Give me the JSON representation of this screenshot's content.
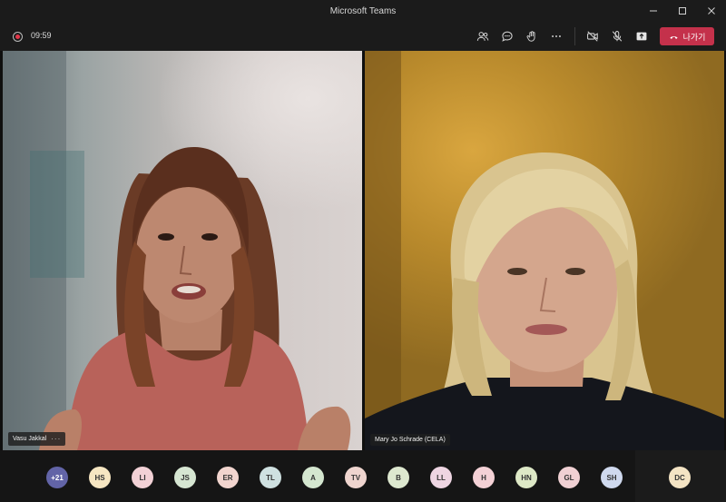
{
  "window": {
    "title": "Microsoft Teams"
  },
  "toolbar": {
    "timer": "09:59",
    "leave_label": "나가기"
  },
  "participants": {
    "left": {
      "name": "Vasu Jakkal",
      "more": "···"
    },
    "right": {
      "name": "Mary Jo Schrade (CELA)"
    }
  },
  "roster": {
    "overflow": "+21",
    "avatars": [
      "HS",
      "LI",
      "JS",
      "ER",
      "TL",
      "A",
      "TV",
      "B",
      "LL",
      "H",
      "HN",
      "GL",
      "SH"
    ],
    "self": "DC"
  },
  "colors": {
    "overflow_bg": "#6264a7",
    "leave": "#c4314b",
    "avatar_bgs": [
      "#f6e6c2",
      "#f2d1d6",
      "#d6e6d2",
      "#f2d5cf",
      "#cfe1e1",
      "#d4e6cf",
      "#efd5cf",
      "#dde8cf",
      "#eed5e2",
      "#f4d1d6",
      "#dde8c6",
      "#f0d0d3",
      "#cfd9ee"
    ],
    "self_bg": "#f4e4c4"
  }
}
